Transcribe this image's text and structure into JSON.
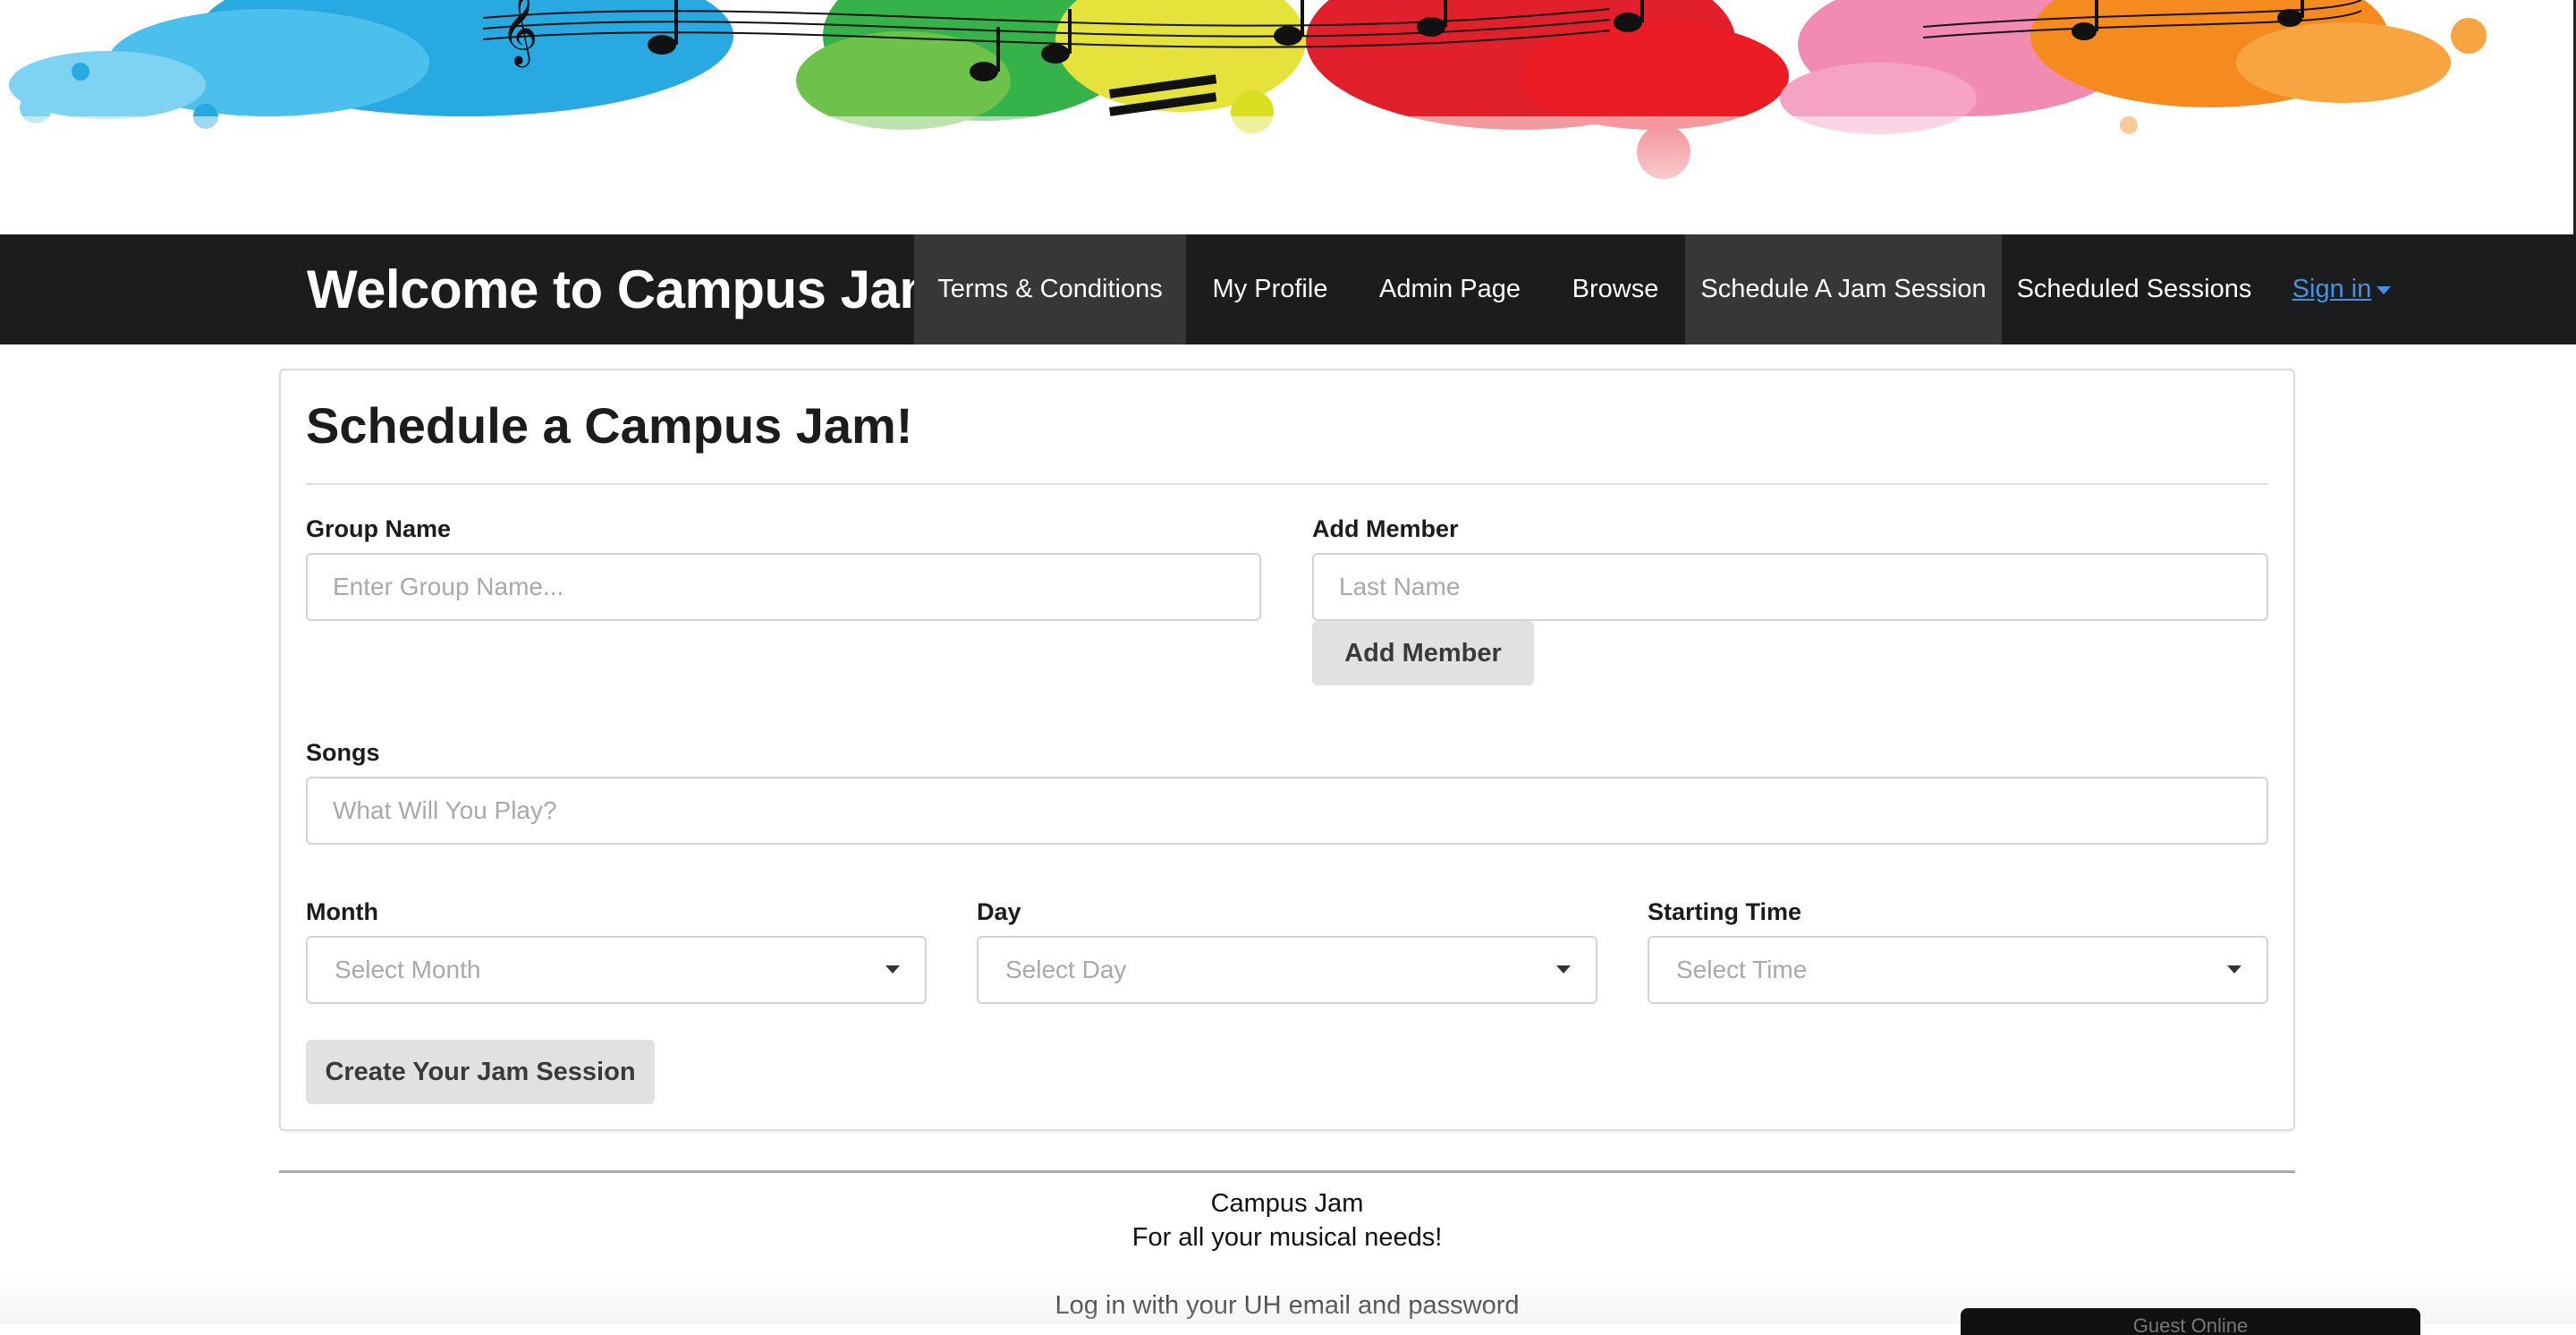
{
  "banner": {
    "icon": "music-paint-splash-banner"
  },
  "navbar": {
    "brand": "Welcome to Campus Jam!",
    "items": [
      {
        "label": "Terms & Conditions",
        "active": true
      },
      {
        "label": "My Profile",
        "active": false
      },
      {
        "label": "Admin Page",
        "active": false
      },
      {
        "label": "Browse",
        "active": false
      },
      {
        "label": "Schedule A Jam Session",
        "active": true
      },
      {
        "label": "Scheduled Sessions",
        "active": false
      }
    ],
    "signin": "Sign in",
    "signin_color": "#4a90e2"
  },
  "form": {
    "title": "Schedule a Campus Jam!",
    "group_name": {
      "label": "Group Name",
      "placeholder": "Enter Group Name...",
      "value": ""
    },
    "add_member": {
      "label": "Add Member",
      "placeholder": "Last Name",
      "value": "",
      "button": "Add Member"
    },
    "songs": {
      "label": "Songs",
      "placeholder": "What Will You Play?",
      "value": ""
    },
    "month": {
      "label": "Month",
      "selected": "Select Month"
    },
    "day": {
      "label": "Day",
      "selected": "Select Day"
    },
    "time": {
      "label": "Starting Time",
      "selected": "Select Time"
    },
    "submit": "Create Your Jam Session"
  },
  "footer": {
    "line1": "Campus Jam",
    "line2": "For all your musical needs!",
    "line3": "Log in with your UH email and password",
    "widget_text": "Guest Online"
  },
  "colors": {
    "navbar_bg": "#1b1c1d",
    "nav_active_bg": "#363738",
    "button_bg": "#e0e1e2"
  }
}
